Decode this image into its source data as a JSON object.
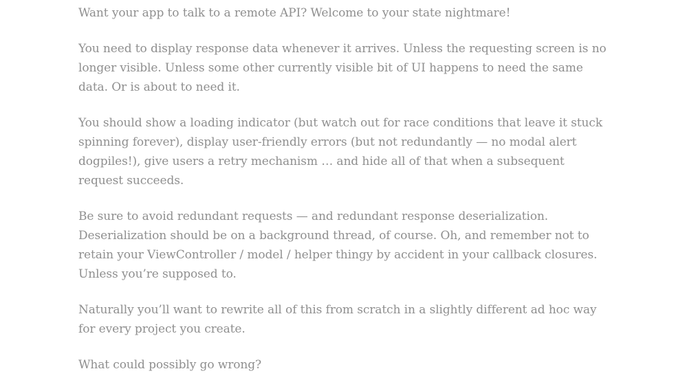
{
  "paragraphs": [
    "Want your app to talk to a remote API? Welcome to your state nightmare!",
    "You need to display response data whenever it arrives. Unless the requesting screen is no longer visible. Unless some other currently visible bit of UI happens to need the same data. Or is about to need it.",
    "You should show a loading indicator (but watch out for race conditions that leave it stuck spinning forever), display user-friendly errors (but not redundantly — no modal alert dogpiles!), give users a retry mechanism … and hide all of that when a subsequent request succeeds.",
    "Be sure to avoid redundant requests — and redundant response deserialization. Deserialization should be on a background thread, of course. Oh, and remember not to retain your ViewController / model / helper thingy by accident in your callback closures. Unless you’re supposed to.",
    "Naturally you’ll want to rewrite all of this from scratch in a slightly different ad hoc way for every project you create.",
    "What could possibly go wrong?"
  ],
  "colors": {
    "text": "#8f8f8f",
    "background": "#ffffff"
  }
}
